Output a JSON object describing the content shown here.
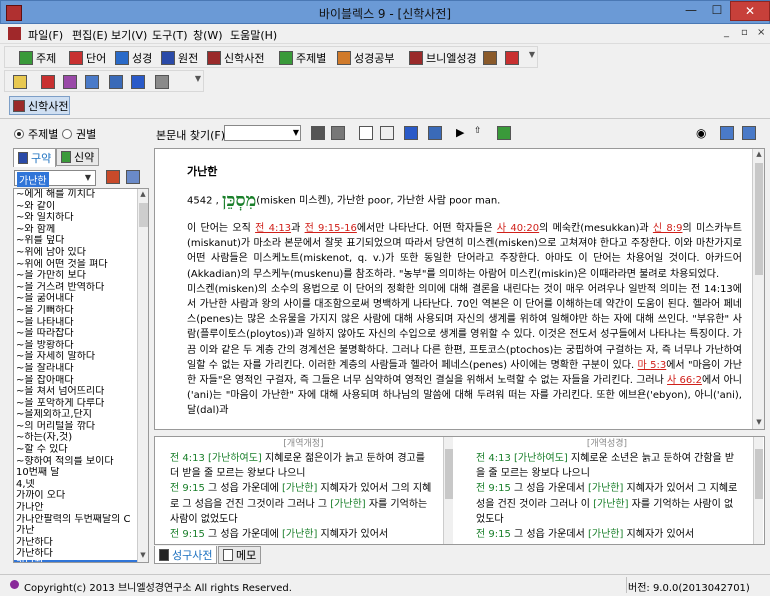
{
  "window": {
    "title": "바이블렉스 9 - [신학사전]",
    "min": "—",
    "max": "☐",
    "close": "✕"
  },
  "menu": {
    "items": [
      "파일(F)",
      "편집(E)",
      "보기(V)",
      "도구(T)",
      "창(W)",
      "도움말(H)"
    ],
    "right": [
      "_",
      "▫",
      "×"
    ]
  },
  "toolbar1": {
    "buttons": [
      "주제",
      "단어",
      "성경",
      "원전",
      "신학사전",
      "주제별",
      "성경공부",
      "브니엘성경"
    ]
  },
  "active_tab": "신학사전",
  "left": {
    "radio1": "주제별",
    "radio2": "권별",
    "tab1": "구약",
    "tab2": "신약",
    "combo_value": "가난한",
    "items": [
      "~에게 해를 끼치다",
      "~와 같이",
      "~와 일치하다",
      "~와 함께",
      "~위를 덮다",
      "~위에 남아 있다",
      "~위에 어떤 것을 펴다",
      "~을 가만히 보다",
      "~을 거스려 반역하다",
      "~을 굶어내다",
      "~을 기뻐하다",
      "~을 나타내다",
      "~을 따라잡다",
      "~을 방황하다",
      "~을 자세히 말하다",
      "~을 잘라내다",
      "~을 잡아매다",
      "~을 쳐서 넘어뜨리다",
      "~을 포악하게 다루다",
      "~을제외하고,단지",
      "~의 머리털을 깎다",
      "~하는(자,것)",
      "~할 수 있다",
      "~향하여 적의를 보이다",
      "10번째 달",
      "4,넷",
      "가까이 오다",
      "가나안",
      "가나안팔력의 두번째달의 C",
      "가난",
      "가난하다",
      "가난하다",
      "가난한",
      "가난한"
    ],
    "selected_index": 32
  },
  "content_toolbar": {
    "find_label": "본문내 찾기(F):"
  },
  "article": {
    "heading": "가난한",
    "hebrew": "מִסְכֵּן",
    "gloss": ", 4542(misken 미스켄), 가난한 poor, 가난한 사람 poor man.",
    "p1": [
      {
        "t": "이 단어는 오직 "
      },
      {
        "r": "전 4:13"
      },
      {
        "t": "과 "
      },
      {
        "r": "전 9:15-16"
      },
      {
        "t": "에서만 나타난다. 어떤 학자들은 "
      },
      {
        "r": "사 40:20"
      },
      {
        "t": "의 메숙칸(mesukkan)과 "
      },
      {
        "r": "신 8:9"
      },
      {
        "t": "의 미스카누트(miskanut)가 마소라 본문에서 잘못 표기되었으며 따라서 당연히 미스켄(misken)으로 고쳐져야 한다고 주장한다. 이와 마찬가지로 어떤 사람들은 미스케노트(miskenot, q. v.)가 또한 동일한 단어라고 주장한다. 아마도 이 단어는 차용어일 것이다. 아카드어(Akkadian)의 무스케누(muskenu)를 참조하라. \"농부\"를 의미하는 아람어 미스킨(miskin)은 이때라라면 불려로 차용되었다."
      }
    ],
    "p2": [
      {
        "t": "미스켄(misken)의 소수의 용법으로 이 단어의 정확한 의미에 대해 결론을 내린다는 것이 매우 어려우나 일반적 의미는 전 14:13에서 가난한 사람과 왕의 사이를 대조함으로써 명백하게 나타난다. 70인 역본은 이 단어를 이해하는데 약간이 도움이 된다. 헬라어 페네스(penes)는 많은 소유물을 가지지 않은 사람에 대해 사용되며 자신의 생계를 위하여 일해야만 하는 자에 대해 쓰인다. \"부유한\" 사람(플루이토스(ploytos))과 일하지 않아도 자신의 수입으로 생계를 영위할 수 있다. 이것은 전도서 성구들에서 나타나는 특징이다. 가끔 이와 같은 두 계층 간의 경계선은 불명확하다. 그러나 다른 한편, 프토코스(ptochos)는 궁핍하여 구걸하는 자, 즉 너무나 가난하여 일할 수 없는 자를 가리킨다. 이러한 계층의 사람들과 헬라어 페네스(penes) 사이에는 명확한 구분이 있다. "
      },
      {
        "r": "마 5:3"
      },
      {
        "t": "에서 \"마음이 가난한 자들\"은 영적인 구걸자, 즉 그들은 너무 심약하여 영적인 결실을 위해서 노력할 수 없는 자들을 가리킨다. 그러나 "
      },
      {
        "r": "사 66:2"
      },
      {
        "t": "에서 아니('ani)는 \"마음이 가난한\" 자에 대해 사용되며 하나님의 말씀에 대해 두려워 떠는 자를 가리킨다. 또한 에브욘('ebyon), 아니('ani), 달(dal)과"
      }
    ]
  },
  "bottom": {
    "left_title": "[개역개정]",
    "right_title": "[개역성경]",
    "left": [
      {
        "v": "전  4:13",
        "g": "[가난하여도]",
        "t": " 지혜로운 젊은이가 늙고 둔하여 경고를 더 받을 줄 모르는 왕보다 나으니"
      },
      {
        "v": "전 9:15",
        "t": " 그 성읍 가운데에 ",
        "g": "[가난한]",
        "t2": " 지혜자가 있어서 그의 지혜로 그 성읍을 건진 그것이라 그러나 그 ",
        "g2": "[가난한]",
        "t3": " 자를 기억하는 사람이 없었도다"
      },
      {
        "v": "전 9:15",
        "t": " 그 성읍 가운데에 ",
        "g": "[가난한]",
        "t2": " 지혜자가 있어서"
      }
    ],
    "right": [
      {
        "v": "전  4:13",
        "g": "[가난하여도]",
        "t": " 지혜로운 소년은 늙고 둔하여 간함을 받을 줄 모르는 왕보다 나으니"
      },
      {
        "v": "전 9:15",
        "t": " 그 성읍 가운데서 ",
        "g": "[가난한]",
        "t2": " 지혜자가 있어서 그 지혜로 성을 건진 것이라 그러나 이 ",
        "g2": "[가난한]",
        "t3": " 자를 기억하는 사람이 없었도다"
      },
      {
        "v": "전 9:15",
        "t": " 그 성읍 가운데서 ",
        "g": "[가난한]",
        "t2": " 지혜자가 있어서"
      }
    ],
    "tab1": "성구사전",
    "tab2": "메모"
  },
  "status": {
    "copyright": "Copyright(c) 2013 브니엘성경연구소 All rights Reserved.",
    "version": "버전: 9.0.0(2013042701)"
  }
}
